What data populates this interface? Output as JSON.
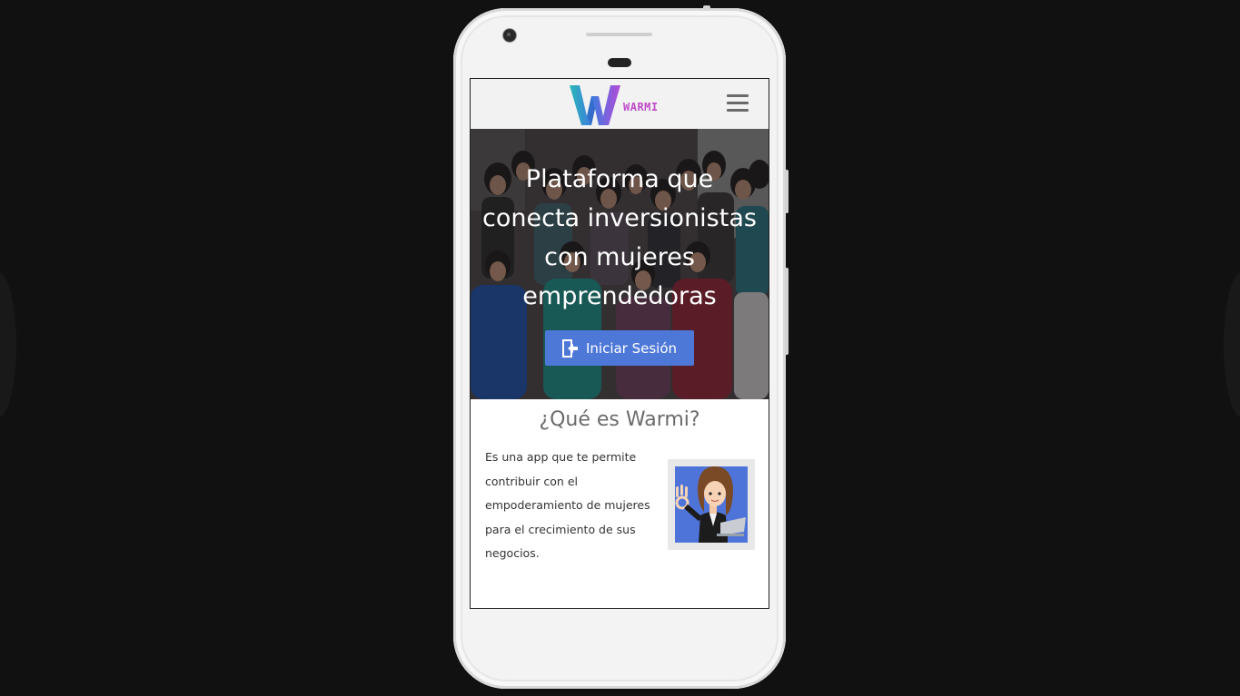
{
  "app": {
    "brand_name": "WARMI",
    "colors": {
      "background": "#121112",
      "accent": "#4e78d8",
      "brand_pink": "#c04ac8",
      "brand_teal": "#2ab7b7"
    }
  },
  "header": {
    "menu_icon": "hamburger-icon"
  },
  "hero": {
    "title": "Plataforma que\nconecta inversionistas\ncon mujeres\nemprendedoras",
    "login_button_label": "Iniciar Sesión",
    "login_icon": "sign-in-icon"
  },
  "about": {
    "title": "¿Qué es Warmi?",
    "description": "Es una app que te permite contribuir con el empoderamiento de mujeres para el crecimiento de sus negocios.",
    "illustration": "businesswoman-ok-gesture-illustration"
  }
}
